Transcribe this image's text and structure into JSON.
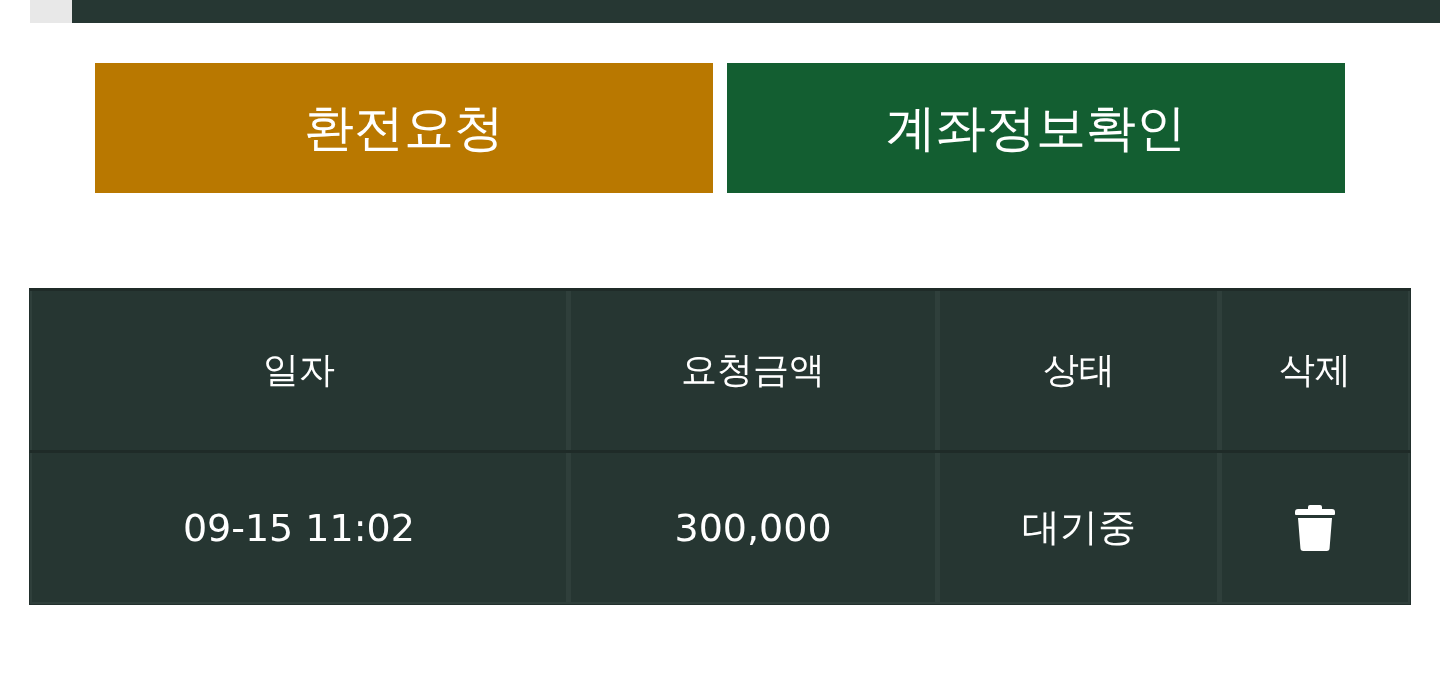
{
  "buttons": [
    {
      "label": "환전요청",
      "color": "#b97800"
    },
    {
      "label": "계좌정보확인",
      "color": "#135e31"
    }
  ],
  "table": {
    "columns": [
      "일자",
      "요청금액",
      "상태",
      "삭제"
    ],
    "rows": [
      {
        "cells": [
          {
            "kind": "text",
            "text": "09-15 11:02"
          },
          {
            "kind": "text",
            "text": "300,000"
          },
          {
            "kind": "text",
            "text": "대기중"
          },
          {
            "kind": "delete"
          }
        ]
      }
    ]
  }
}
